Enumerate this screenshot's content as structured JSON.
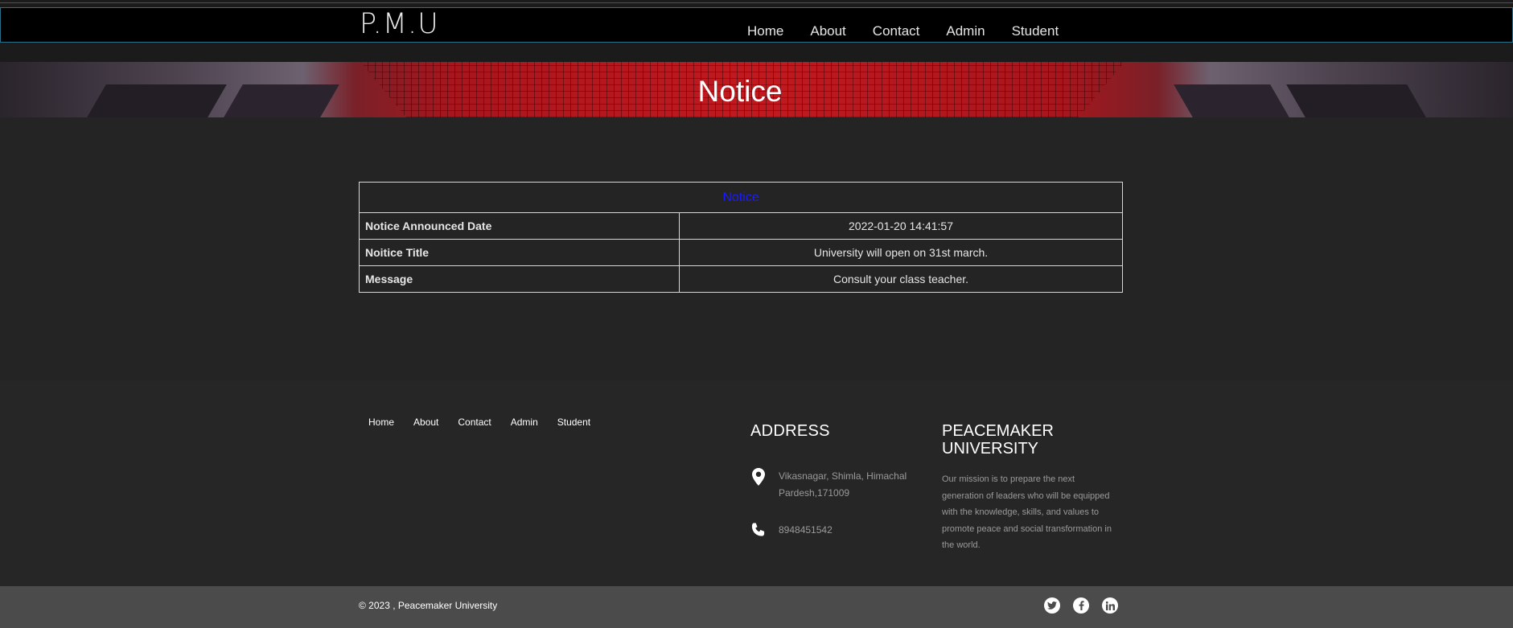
{
  "header": {
    "logo": "P.M.U",
    "nav": [
      "Home",
      "About",
      "Contact",
      "Admin",
      "Student"
    ]
  },
  "hero": {
    "title": "Notice"
  },
  "notice": {
    "caption": "Notice",
    "rows": [
      {
        "label": "Notice Announced Date",
        "value": "2022-01-20 14:41:57"
      },
      {
        "label": "Noitice Title",
        "value": "University will open on 31st march."
      },
      {
        "label": "Message",
        "value": "Consult your class teacher."
      }
    ]
  },
  "footer": {
    "nav": [
      "Home",
      "About",
      "Contact",
      "Admin",
      "Student"
    ],
    "address_title": "ADDRESS",
    "address": "Vikasnagar, Shimla, Himachal Pardesh,171009",
    "phone": "8948451542",
    "university_title": "PEACEMAKER UNIVERSITY",
    "mission": "Our mission is to prepare the next generation of leaders who will be equipped with the knowledge, skills, and values to promote peace and social transformation in the world.",
    "copyright": "© 2023 , Peacemaker University",
    "social": [
      "twitter-icon",
      "facebook-icon",
      "linkedin-icon"
    ]
  },
  "colors": {
    "nav_border": "#2a6f8a",
    "notice_caption": "#1a1aff",
    "page_bg": "#242424",
    "bottom_bar": "#4b4b4b"
  }
}
